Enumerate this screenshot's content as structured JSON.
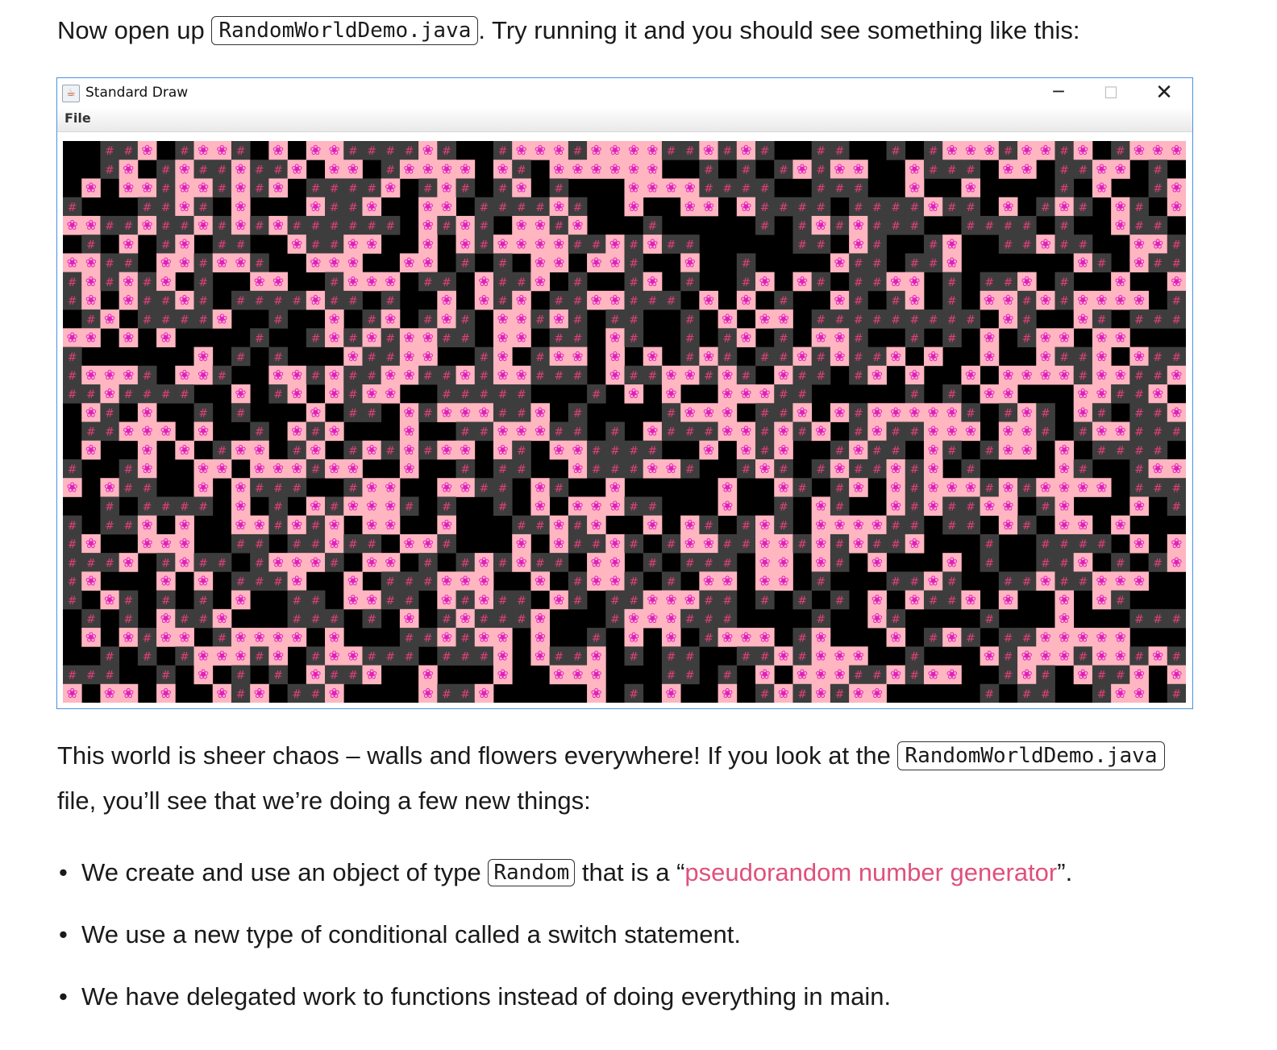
{
  "intro": {
    "before": "Now open up ",
    "code": "RandomWorldDemo.java",
    "after": ". Try running it and you should see something like this:"
  },
  "window": {
    "title": "Standard Draw",
    "minimize_glyph": "─",
    "maximize_glyph": "☐",
    "close_glyph": "✕",
    "menu_file": "File",
    "tiles": {
      "wall_glyph": "#",
      "flower_glyph": "❀",
      "colors": {
        "nothing": "#000000",
        "wall_bg": "#3d3d3d",
        "wall_fg": "#e0407a",
        "flower_bg": "#ffb6c1",
        "flower_fg": "#e020c0"
      }
    }
  },
  "para2": {
    "before": "This world is sheer chaos – walls and flowers everywhere! If you look at the ",
    "code": "RandomWorldDemo.java",
    "after": " file, you’ll see that we’re doing a few new things:"
  },
  "bullets": [
    {
      "before": "We create and use an object of type ",
      "code": "Random",
      "middle": " that is a “",
      "link": "pseudorandom number generator",
      "after": "”."
    },
    {
      "text": "We use a new type of conditional called a switch statement."
    },
    {
      "text": "We have delegated work to functions instead of doing everything in main."
    }
  ],
  "bullet_glyph": "•",
  "link_color": "#e0507d"
}
